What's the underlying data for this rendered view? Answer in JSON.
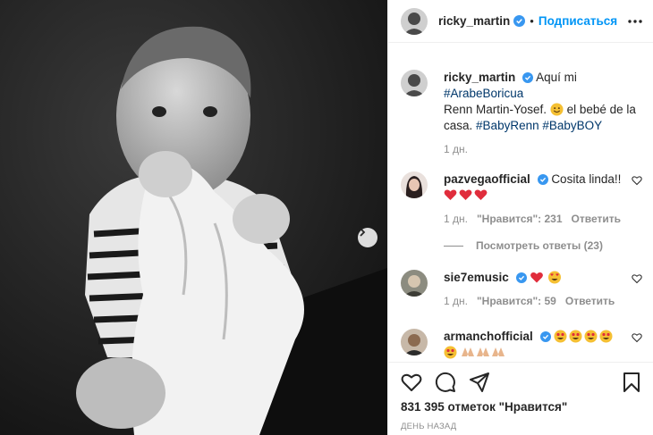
{
  "header": {
    "username": "ricky_martin",
    "separator": "•",
    "follow_label": "Подписаться"
  },
  "caption": {
    "username": "ricky_martin",
    "text_1": "Aquí mi",
    "hashtag_1": "#ArabeBoricua",
    "text_2": "Renn Martin-Yosef.",
    "text_3": "el bebé de la casa.",
    "hashtag_2": "#BabyRenn",
    "hashtag_3": "#BabyBOY",
    "time": "1 дн."
  },
  "comments": [
    {
      "username": "pazvegaofficial",
      "text": "Cosita linda!!",
      "time": "1 дн.",
      "likes": "\"Нравится\": 231",
      "reply_label": "Ответить",
      "replies_label": "Посмотреть ответы (23)"
    },
    {
      "username": "sie7emusic",
      "time": "1 дн.",
      "likes": "\"Нравится\": 59",
      "reply_label": "Ответить"
    },
    {
      "username": "armanchofficial"
    }
  ],
  "footer": {
    "likes_count": "831 395 отметок \"Нравится\"",
    "posted_ago": "ДЕНЬ НАЗАД"
  },
  "icons": {
    "more": "more-icon",
    "next": "chevron-right-icon",
    "like": "heart-icon",
    "comment": "comment-icon",
    "share": "share-icon",
    "save": "bookmark-icon"
  },
  "colors": {
    "link": "#0095f6",
    "hashtag": "#00376b",
    "verified": "#3897f0",
    "muted": "#8e8e8e"
  }
}
